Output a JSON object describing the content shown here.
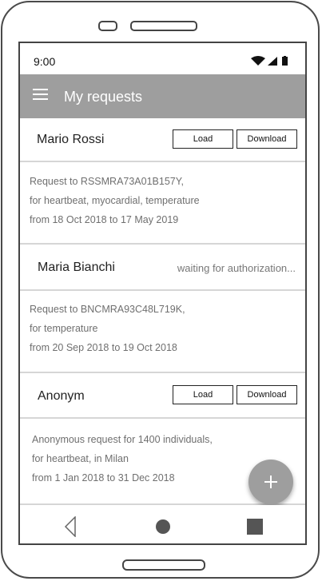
{
  "status_bar": {
    "time": "9:00",
    "icons": [
      "wifi-icon",
      "signal-icon",
      "battery-icon"
    ]
  },
  "app_bar": {
    "title": "My requests",
    "menu_icon": "hamburger-menu-icon",
    "background": "#9e9e9e"
  },
  "requests": [
    {
      "name": "Mario Rossi",
      "status": "ready",
      "actions": {
        "load": "Load",
        "download": "Download"
      },
      "details": [
        "Request to RSSMRA73A01B157Y,",
        "for heartbeat, myocardial, temperature",
        "from 18 Oct 2018 to 17 May 2019"
      ]
    },
    {
      "name": "Maria Bianchi",
      "status": "waiting for authorization...",
      "details": [
        "Request to BNCMRA93C48L719K,",
        "for temperature",
        "from 20 Sep 2018 to 19 Oct 2018"
      ]
    },
    {
      "name": "Anonym",
      "status": "ready",
      "actions": {
        "load": "Load",
        "download": "Download"
      },
      "details": [
        "Anonymous request for 1400 individuals,",
        "for heartbeat, in Milan",
        "from 1 Jan 2018 to 31 Dec 2018"
      ]
    }
  ],
  "fab": {
    "icon": "plus-icon"
  },
  "nav_bar": {
    "icons": [
      "back-triangle-icon",
      "home-circle-icon",
      "recents-square-icon"
    ]
  }
}
